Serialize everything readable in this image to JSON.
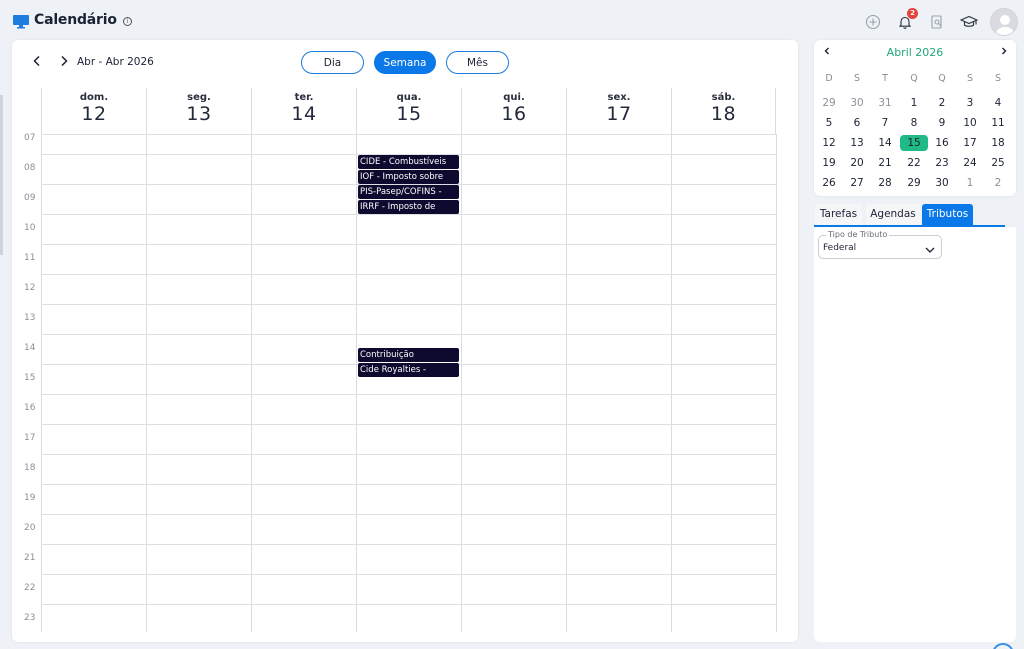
{
  "header": {
    "title": "Calendário",
    "notification_count": "2",
    "icons": [
      "plus-circle-icon",
      "bell-icon",
      "search-document-icon",
      "graduation-cap-icon",
      "avatar-icon"
    ]
  },
  "calendar": {
    "range_label": "Abr - Abr 2026",
    "views": [
      {
        "label": "Dia",
        "active": false
      },
      {
        "label": "Semana",
        "active": true
      },
      {
        "label": "Mês",
        "active": false
      }
    ],
    "days": [
      {
        "name": "dom.",
        "num": "12"
      },
      {
        "name": "seg.",
        "num": "13"
      },
      {
        "name": "ter.",
        "num": "14"
      },
      {
        "name": "qua.",
        "num": "15"
      },
      {
        "name": "qui.",
        "num": "16"
      },
      {
        "name": "sex.",
        "num": "17"
      },
      {
        "name": "sáb.",
        "num": "18"
      }
    ],
    "hours": [
      "07",
      "08",
      "09",
      "10",
      "11",
      "12",
      "13",
      "14",
      "15",
      "16",
      "17",
      "18",
      "19",
      "20",
      "21",
      "22",
      "23"
    ],
    "events": [
      {
        "label": "CIDE - Combustíveis",
        "day": "qua.",
        "hour": "08"
      },
      {
        "label": "IOF - Imposto sobre",
        "day": "qua.",
        "hour": "08"
      },
      {
        "label": "PIS-Pasep/COFINS -",
        "day": "qua.",
        "hour": "09"
      },
      {
        "label": "IRRF - Imposto de",
        "day": "qua.",
        "hour": "09"
      },
      {
        "label": "Contribuição",
        "day": "qua.",
        "hour": "14"
      },
      {
        "label": "Cide Royalties -",
        "day": "qua.",
        "hour": "15"
      }
    ]
  },
  "mini_calendar": {
    "title": "Abril 2026",
    "weekdays": [
      "D",
      "S",
      "T",
      "Q",
      "Q",
      "S",
      "S"
    ],
    "weeks": [
      [
        "29",
        "30",
        "31",
        "1",
        "2",
        "3",
        "4"
      ],
      [
        "5",
        "6",
        "7",
        "8",
        "9",
        "10",
        "11"
      ],
      [
        "12",
        "13",
        "14",
        "15",
        "16",
        "17",
        "18"
      ],
      [
        "19",
        "20",
        "21",
        "22",
        "23",
        "24",
        "25"
      ],
      [
        "26",
        "27",
        "28",
        "29",
        "30",
        "1",
        "2"
      ]
    ],
    "today": "15",
    "accent_color": "#1fba86"
  },
  "side_tabs": {
    "tabs": [
      {
        "label": "Tarefas",
        "active": false
      },
      {
        "label": "Agendas",
        "active": false
      },
      {
        "label": "Tributos",
        "active": true
      }
    ],
    "filter": {
      "legend": "Tipo de Tributo",
      "value": "Federal"
    }
  },
  "colors": {
    "primary": "#0a78e8",
    "event": "#0e0a2f",
    "today": "#1fba86"
  }
}
